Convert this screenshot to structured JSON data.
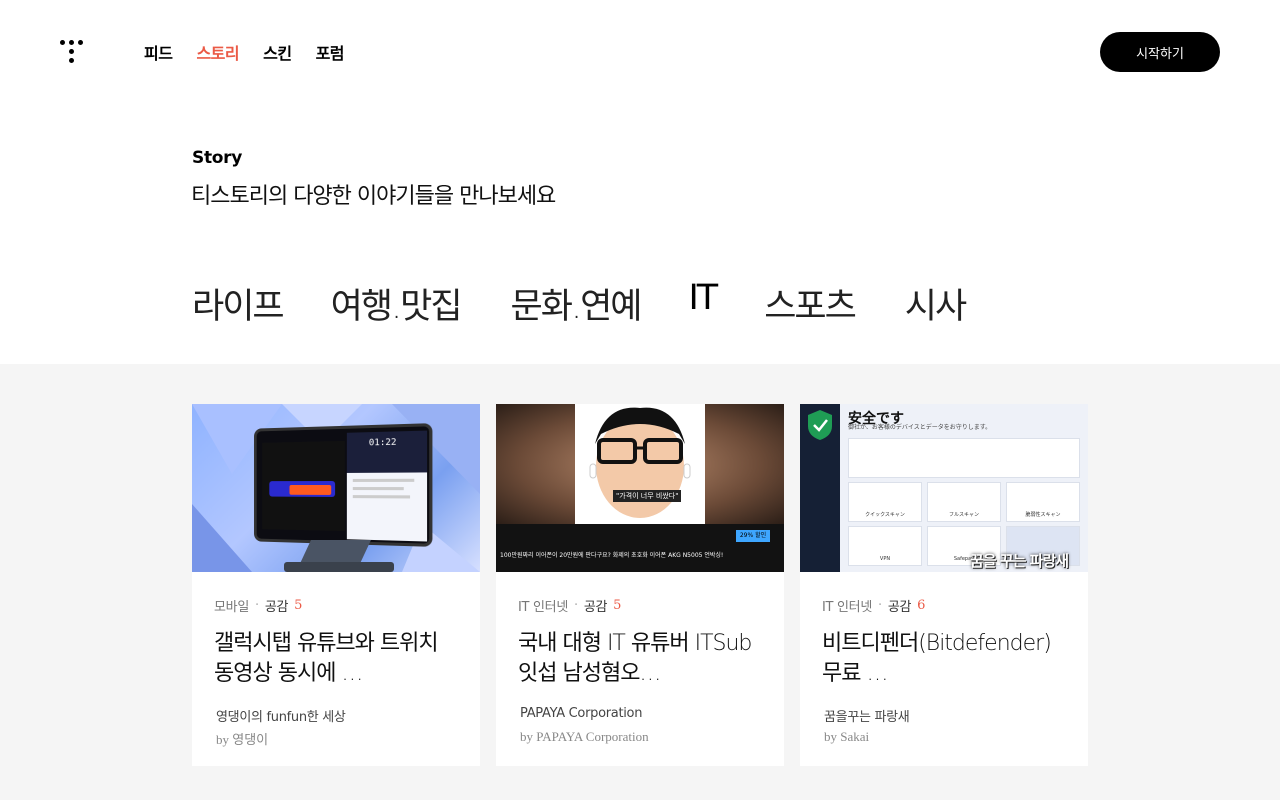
{
  "header": {
    "logo": "tistory-logo-icon",
    "nav": [
      {
        "label": "피드",
        "active": false
      },
      {
        "label": "스토리",
        "active": true
      },
      {
        "label": "스킨",
        "active": false
      },
      {
        "label": "포럼",
        "active": false
      }
    ],
    "start_label": "시작하기"
  },
  "hero": {
    "label": "Story",
    "subtitle": "티스토리의 다양한 이야기들을 만나보세요"
  },
  "categories": [
    {
      "label": "라이프",
      "active": false
    },
    {
      "label": "여행.맛집",
      "active": false
    },
    {
      "label": "문화.연예",
      "active": false
    },
    {
      "label": "IT",
      "active": true
    },
    {
      "label": "스포츠",
      "active": false
    },
    {
      "label": "시사",
      "active": false
    }
  ],
  "cards": [
    {
      "category": "모바일",
      "likes_label": "공감",
      "likes": "5",
      "title": "갤럭시탭 유튜브와 트위치 동영상 동시에 …",
      "blog": "영댕이의 funfun한 세상",
      "author": "by 영댕이",
      "thumb_text": "01:22"
    },
    {
      "category": "IT 인터넷",
      "likes_label": "공감",
      "likes": "5",
      "title": "국내 대형 IT 유튜버 ITSub잇섭 남성혐오…",
      "blog": "PAPAYA Corporation",
      "author": "by PAPAYA Corporation",
      "thumb_text": "100만원짜리 이어폰이 20만원에 판다구요? 화제의 초호화 이어폰 AKG N5005 언박싱!",
      "thumb_caption": "\"가격이 너무 비쌌다\"",
      "thumb_badge": "29% 할인"
    },
    {
      "category": "IT 인터넷",
      "likes_label": "공감",
      "likes": "6",
      "title": "비트디펜더(Bitdefender) 무료 …",
      "blog": "꿈을꾸는 파랑새",
      "author": "by Sakai",
      "thumb_header": "安全です",
      "thumb_sub": "御社が、お客様のデバイスとデータをお守りします。",
      "thumb_watermark": "꿈을 꾸는 파랑새",
      "thumb_tiles": [
        "クイックスキャン",
        "フルスキャン",
        "脆弱性スキャン",
        "VPN",
        "Safepay",
        ""
      ]
    }
  ]
}
